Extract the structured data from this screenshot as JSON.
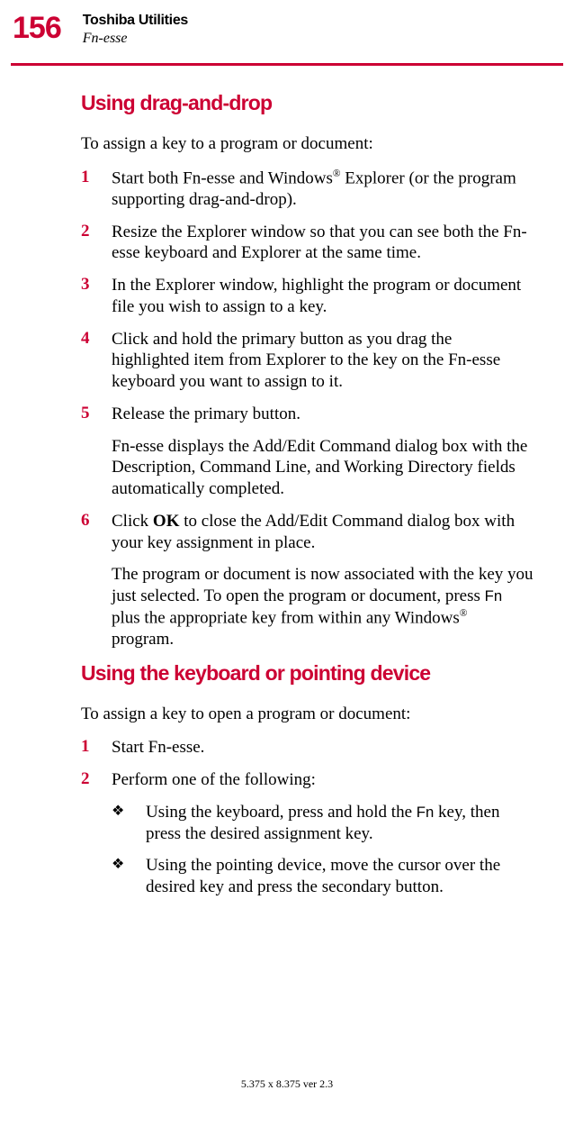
{
  "header": {
    "page_number": "156",
    "title": "Toshiba Utilities",
    "subsection": "Fn-esse"
  },
  "section1": {
    "heading": "Using drag-and-drop",
    "intro": "To assign a key to a program or document:",
    "steps": {
      "s1_pre": "Start both Fn-esse and Windows",
      "s1_post": " Explorer (or the program supporting drag-and-drop).",
      "s2": "Resize the Explorer window so that you can see both the Fn-esse keyboard and Explorer at the same time.",
      "s3": "In the Explorer window, highlight the program or document file you wish to assign to a key.",
      "s4": "Click and hold the primary button as you drag the highlighted item from Explorer to the key on the Fn-esse keyboard you want to assign to it.",
      "s5": "Release the primary button.",
      "s5_follow": "Fn-esse displays the Add/Edit Command dialog box with the Description, Command Line, and Working Directory fields automatically completed.",
      "s6_pre": "Click ",
      "s6_bold": "OK",
      "s6_post": " to close the Add/Edit Command dialog box with your key assignment in place.",
      "s6_follow_pre": "The program or document is now associated with the key you just selected. To open the program or document, press ",
      "s6_follow_fn": "Fn",
      "s6_follow_mid": " plus the appropriate key from within any Windows",
      "s6_follow_post": " program."
    }
  },
  "section2": {
    "heading": "Using the keyboard or pointing device",
    "intro": "To assign a key to open a program or document:",
    "steps": {
      "s1": "Start Fn-esse.",
      "s2": "Perform one of the following:",
      "b1_pre": "Using the keyboard, press and hold the ",
      "b1_fn": "Fn",
      "b1_post": " key, then press the desired assignment key.",
      "b2": "Using the pointing device, move the cursor over the desired key and press the secondary button."
    }
  },
  "footer": "5.375 x 8.375 ver 2.3",
  "nums": {
    "n1": "1",
    "n2": "2",
    "n3": "3",
    "n4": "4",
    "n5": "5",
    "n6": "6"
  },
  "bullet": "❖"
}
